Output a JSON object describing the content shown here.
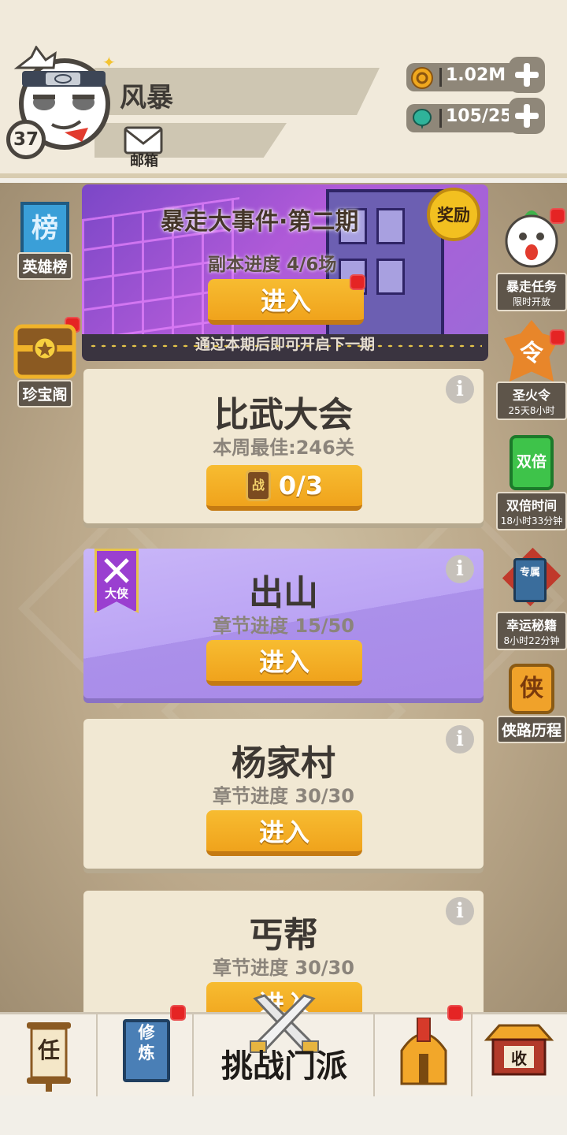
{
  "player": {
    "name": "风暴",
    "level": "37",
    "mail_label": "邮箱"
  },
  "resources": {
    "gold": "1.02M",
    "gems": "105/25"
  },
  "event": {
    "title": "暴走大事件·第二期",
    "progress": "副本进度 4/6场",
    "enter_label": "进入",
    "footer": "通过本期后即可开启下一期",
    "reward_label": "奖励"
  },
  "cards": [
    {
      "title": "比武大会",
      "subtitle": "本周最佳:246关",
      "button": "0/3",
      "button_icon": "战"
    },
    {
      "title": "出山",
      "subtitle": "章节进度 15/50",
      "button": "进入",
      "ribbon": "大侠"
    },
    {
      "title": "杨家村",
      "subtitle": "章节进度 30/30",
      "button": "进入"
    },
    {
      "title": "丐帮",
      "subtitle": "章节进度 30/30",
      "button": "进入"
    }
  ],
  "left_side": [
    {
      "label": "英雄榜",
      "icon_text": "榜"
    },
    {
      "label": "珍宝阁"
    }
  ],
  "right_side": [
    {
      "label": "暴走任务",
      "time": "限时开放"
    },
    {
      "label": "圣火令",
      "time": "25天8小时",
      "icon_text": "令"
    },
    {
      "label": "双倍时间",
      "time": "18小时33分钟",
      "icon_text": "双倍"
    },
    {
      "label": "幸运秘籍",
      "time": "8小时22分钟",
      "icon_text": "专属"
    },
    {
      "label": "侠路历程",
      "icon_text": "侠"
    }
  ],
  "nav": {
    "task_icon_text": "任",
    "cultivate_icon_text": "修炼",
    "center_label": "挑战门派",
    "collect_icon_text": "收"
  },
  "colors": {
    "accent_orange": "#f7b52a",
    "badge_red": "#e52424",
    "purple_card": "#b9a3f3"
  }
}
